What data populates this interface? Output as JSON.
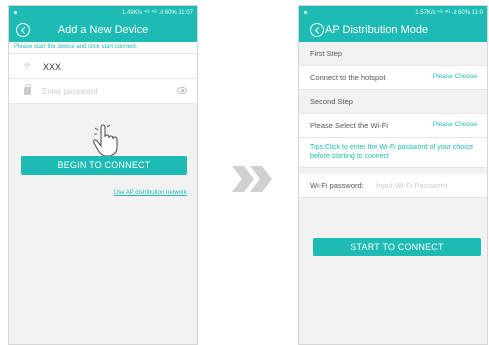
{
  "left": {
    "status": "1.49K/s ⁴ᴳ ⁴ᴳ .ıl 60% 11:07",
    "title": "Add a New Device",
    "hint": "Please start the device and click start connect.",
    "wifi_name": "XXX",
    "password_placeholder": "Enter password",
    "connect_button": "BEGIN TO CONNECT",
    "ap_link": "Use AP distribution network"
  },
  "right": {
    "status": "1.57K/s ⁴ᴳ ⁴ᴳ .ıl 60% 11:0",
    "title": "AP Distribution Mode",
    "first_step": "First Step",
    "connect_hotspot": "Connect to the hotspot",
    "connect_hotspot_value": "Please Choose",
    "second_step": "Second Step",
    "select_wifi": "Please Select the Wi-Fi",
    "select_wifi_value": "Please Choose",
    "tips": "Tips:Click to enter the Wi-Fi password of your choice before starting to connect",
    "wifi_password_label": "Wi-Fi password:",
    "wifi_password_placeholder": "Input Wi-Fi Password",
    "start_button": "START TO CONNECT"
  },
  "colors": {
    "accent": "#1ebbb4",
    "arrow": "#d0d0d0"
  },
  "icons": [
    "back-icon",
    "wifi-icon",
    "lock-icon",
    "eye-icon",
    "pointer-hand-icon",
    "double-chevron-right-icon"
  ]
}
